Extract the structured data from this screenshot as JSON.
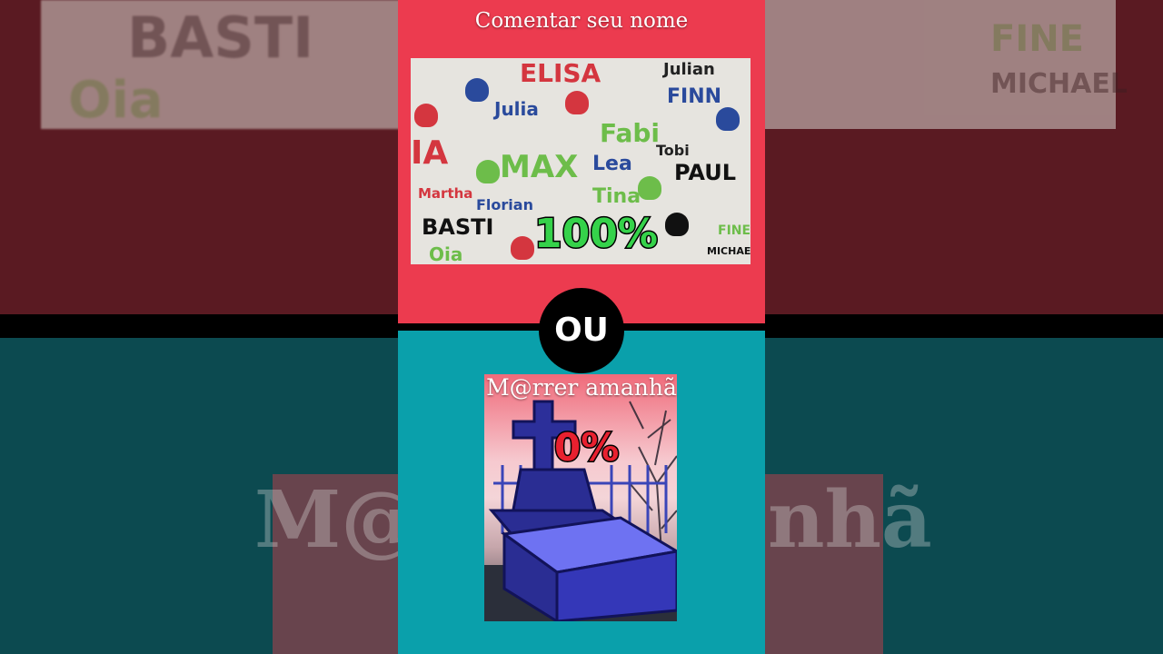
{
  "options": [
    {
      "title": "Comentar seu nome",
      "percent": "100%",
      "image": "handprint-names-wall"
    },
    {
      "title": "M@rrer amanhã",
      "percent": "0%",
      "image": "grave-tombstone"
    }
  ],
  "divider": {
    "label": "OU"
  },
  "wall_names": [
    "ELISA",
    "Julian",
    "Julia",
    "FINN",
    "Fabi",
    "MAX",
    "Lea",
    "Tobi",
    "PAUL",
    "IA",
    "Martha",
    "Florian",
    "Tina",
    "BASTI",
    "Oia",
    "FINE",
    "MICHAEL"
  ],
  "background": {
    "left_words": [
      "BASTI",
      "Oia"
    ],
    "right_words": [
      "FINE",
      "MICHAEL"
    ],
    "bottom_text_left": "M@",
    "bottom_text_right": "nhã"
  },
  "colors": {
    "top_panel": "#ec3b4f",
    "bottom_panel": "#0aa0ab",
    "winner_percent": "#35d24a",
    "loser_percent": "#e8202f"
  }
}
